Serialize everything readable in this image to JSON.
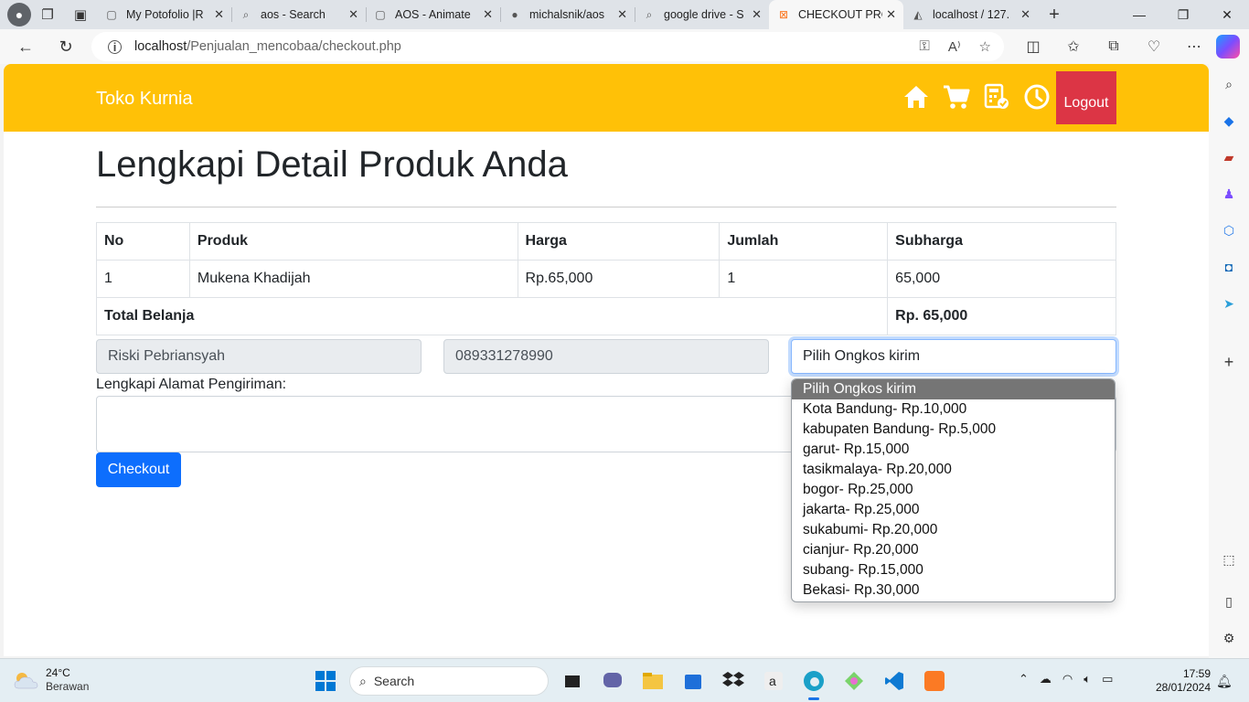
{
  "browser": {
    "tabs": [
      {
        "title": "My Potofolio |R",
        "favicon": "page-icon"
      },
      {
        "title": "aos - Search",
        "favicon": "search-icon"
      },
      {
        "title": "AOS - Animate",
        "favicon": "page-icon"
      },
      {
        "title": "michalsnik/aos",
        "favicon": "github-icon"
      },
      {
        "title": "google drive - S",
        "favicon": "search-icon"
      },
      {
        "title": "CHECKOUT PRO",
        "favicon": "xampp-icon",
        "active": true
      },
      {
        "title": "localhost / 127.",
        "favicon": "phpmyadmin-icon"
      }
    ],
    "url_host": "localhost",
    "url_path": "/Penjualan_mencobaa/checkout.php"
  },
  "site": {
    "brand": "Toko Kurnia",
    "nav_color": "#ffc107",
    "logout_label": "Logout",
    "nav_icons": [
      "home-icon",
      "cart-icon",
      "invoice-icon",
      "history-icon"
    ]
  },
  "page": {
    "title": "Lengkapi Detail Produk Anda",
    "table": {
      "headers": [
        "No",
        "Produk",
        "Harga",
        "Jumlah",
        "Subharga"
      ],
      "rows": [
        [
          "1",
          "Mukena Khadijah",
          "Rp.65,000",
          "1",
          "65,000"
        ]
      ],
      "total_label": "Total Belanja",
      "total_value": "Rp. 65,000"
    },
    "form": {
      "name_value": "Riski Pebriansyah",
      "phone_value": "089331278990",
      "ongkir_selected": "Pilih Ongkos kirim",
      "address_label": "Lengkapi Alamat Pengiriman:",
      "address_value": "",
      "checkout_label": "Checkout"
    },
    "ongkir_options": [
      "Pilih Ongkos kirim",
      "Kota Bandung- Rp.10,000",
      "kabupaten Bandung- Rp.5,000",
      "garut- Rp.15,000",
      "tasikmalaya- Rp.20,000",
      "bogor- Rp.25,000",
      "jakarta- Rp.25,000",
      "sukabumi- Rp.20,000",
      "cianjur- Rp.20,000",
      "subang- Rp.15,000",
      "Bekasi- Rp.30,000"
    ]
  },
  "taskbar": {
    "weather_temp": "24°C",
    "weather_cond": "Berawan",
    "search_label": "Search",
    "time": "17:59",
    "date": "28/01/2024"
  }
}
